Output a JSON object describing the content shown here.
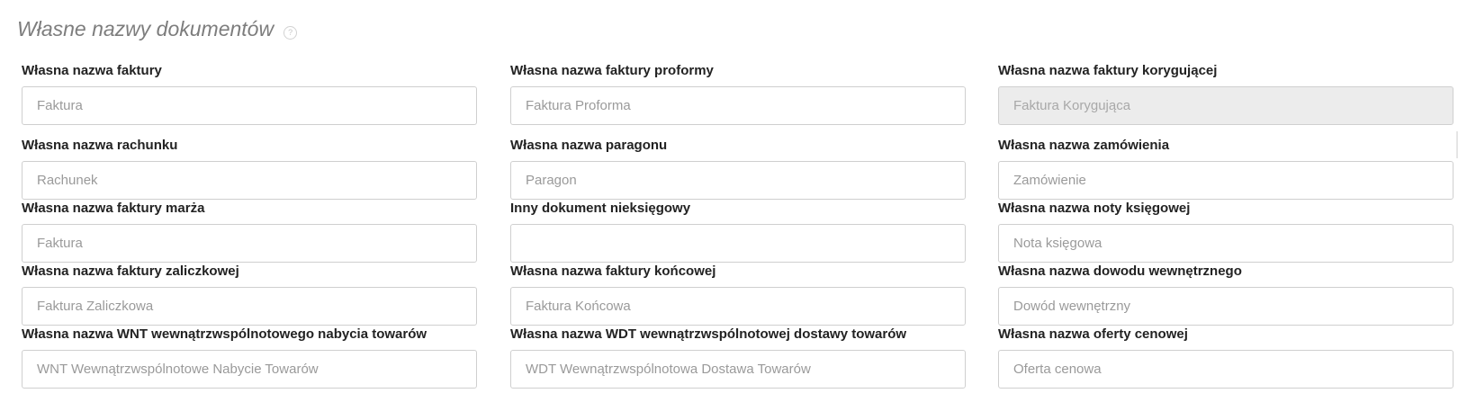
{
  "section": {
    "title": "Własne nazwy dokumentów",
    "help_glyph": "?"
  },
  "fields": [
    {
      "label": "Własna nazwa faktury",
      "value": "",
      "placeholder": "Faktura",
      "disabled": false
    },
    {
      "label": "Własna nazwa faktury proformy",
      "value": "",
      "placeholder": "Faktura Proforma",
      "disabled": false
    },
    {
      "label": "Własna nazwa faktury korygującej",
      "value": "",
      "placeholder": "Faktura Korygująca",
      "disabled": true
    },
    {
      "label": "Własna nazwa rachunku",
      "value": "",
      "placeholder": "Rachunek",
      "disabled": false
    },
    {
      "label": "Własna nazwa paragonu",
      "value": "",
      "placeholder": "Paragon",
      "disabled": false
    },
    {
      "label": "Własna nazwa zamówienia",
      "value": "",
      "placeholder": "Zamówienie",
      "disabled": false
    },
    {
      "label": "Własna nazwa faktury marża",
      "value": "",
      "placeholder": "Faktura",
      "disabled": false
    },
    {
      "label": "Inny dokument nieksięgowy",
      "value": "",
      "placeholder": "",
      "disabled": false
    },
    {
      "label": "Własna nazwa noty księgowej",
      "value": "",
      "placeholder": "Nota księgowa",
      "disabled": false
    },
    {
      "label": "Własna nazwa faktury zaliczkowej",
      "value": "",
      "placeholder": "Faktura Zaliczkowa",
      "disabled": false
    },
    {
      "label": "Własna nazwa faktury końcowej",
      "value": "",
      "placeholder": "Faktura Końcowa",
      "disabled": false
    },
    {
      "label": "Własna nazwa dowodu wewnętrznego",
      "value": "",
      "placeholder": "Dowód wewnętrzny",
      "disabled": false
    },
    {
      "label": "Własna nazwa WNT wewnątrzwspólnotowego nabycia towarów",
      "value": "",
      "placeholder": "WNT Wewnątrzwspólnotowe Nabycie Towarów",
      "disabled": false
    },
    {
      "label": "Własna nazwa WDT wewnątrzwspólnotowej dostawy towarów",
      "value": "",
      "placeholder": "WDT Wewnątrzwspólnotowa Dostawa Towarów",
      "disabled": false
    },
    {
      "label": "Własna nazwa oferty cenowej",
      "value": "",
      "placeholder": "Oferta cenowa",
      "disabled": false
    }
  ],
  "icons": {
    "help": "help-circle-icon"
  },
  "colors": {
    "title": "#7d7d7d",
    "label": "#222222",
    "input_border": "#cfcfcf",
    "disabled_bg": "#ececec",
    "placeholder": "#9a9a9a"
  }
}
